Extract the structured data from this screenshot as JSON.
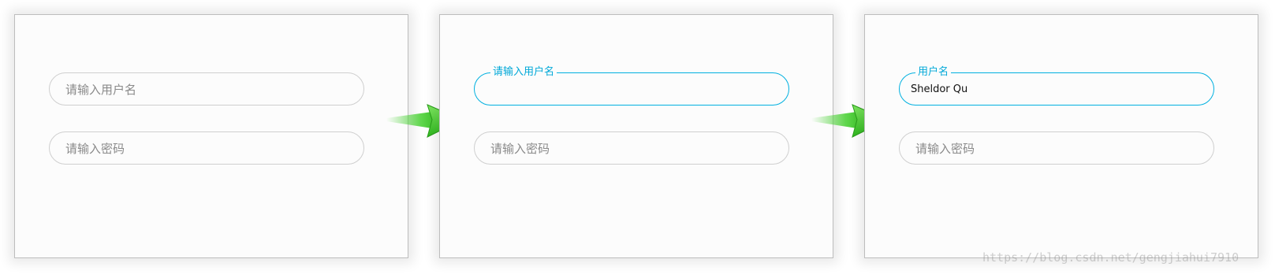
{
  "panels": [
    {
      "username_placeholder": "请输入用户名",
      "password_placeholder": "请输入密码"
    },
    {
      "username_label": "请输入用户名",
      "password_placeholder": "请输入密码"
    },
    {
      "username_label": "用户名",
      "username_value": "Sheldor Qu",
      "password_placeholder": "请输入密码"
    }
  ],
  "arrows": [
    "arrow-right-icon",
    "arrow-right-icon"
  ],
  "colors": {
    "focus_border": "#00b0e0",
    "label": "#00a8d8",
    "arrow_green": "#4fd23a",
    "field_border": "#cfcfcf"
  },
  "watermark": "https://blog.csdn.net/gengjiahui7910"
}
